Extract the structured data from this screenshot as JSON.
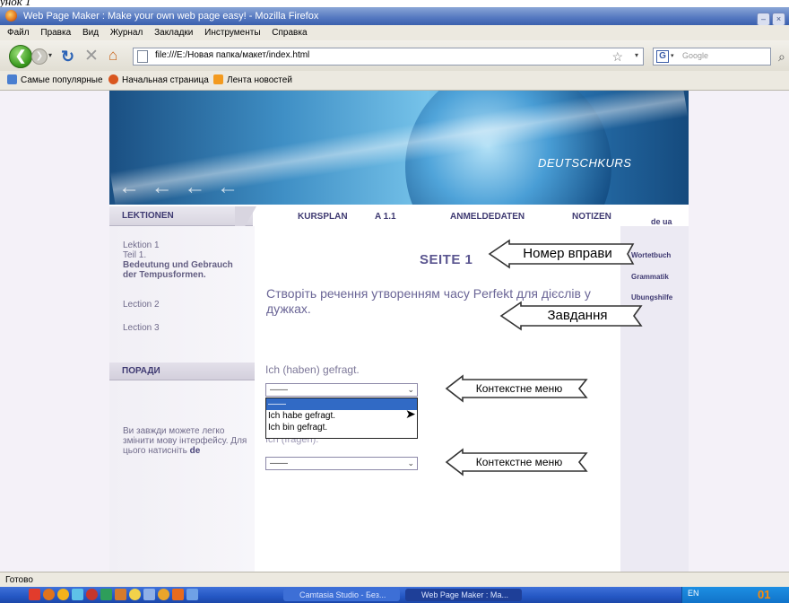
{
  "caption": "унок 1",
  "window": {
    "title": "Web Page Maker : Make your own web page easy! - Mozilla Firefox",
    "minimize": "–",
    "close": "×"
  },
  "menu": [
    "Файл",
    "Правка",
    "Вид",
    "Журнал",
    "Закладки",
    "Инструменты",
    "Справка"
  ],
  "nav": {
    "back_glyph": "❮",
    "forward_glyph": "❯",
    "dropdown_glyph": "▾",
    "reload_glyph": "↻",
    "stop_glyph": "✕",
    "home_glyph": "⌂",
    "url": "file:///E:/Новая папка/макет/index.html",
    "star_glyph": "☆",
    "search_placeholder": "Google",
    "search_engine_glyph": "G",
    "search_go_glyph": "⌕"
  },
  "bookmarks": [
    "Самые популярные",
    "Начальная страница",
    "Лента новостей"
  ],
  "icons": {
    "bookmark_popular": "bookmarks-folder-icon",
    "bookmark_start": "firefox-icon",
    "bookmark_news": "rss-feed-icon"
  },
  "page": {
    "banner_title": "DEUTSCHKURS",
    "banner_arrows": "← ← ← ←",
    "lektionen_header": "LEKTIONEN",
    "topnav": [
      "KURSPLAN",
      "A 1.1",
      "ANMELDEDATEN",
      "NOTIZEN"
    ],
    "lang_switch": "de  ua",
    "lessons": {
      "lektion1": "Lektion 1",
      "teil1": "Teil 1.",
      "teil1_title": "Bedeutung und Gebrauch der Tempusformen.",
      "lection2": "Lection 2",
      "lection3": "Lection 3"
    },
    "tips_header": "ПОРАДИ",
    "tips_text_prefix": "Ви завжди можете легко змінити мову інтерфейсу. Для цього натисніть ",
    "tips_text_bold": "de",
    "side_links": [
      "Wortetbuch",
      "Grammatik",
      "Ubungshilfe"
    ],
    "seite": "SEITE 1",
    "task": "Створіть речення утворенням часу Perfekt для дієслів у дужках.",
    "q1": "Ich (haben) gefragt.",
    "q2": "Ich (fragen).",
    "select1_value": "——",
    "select2_value": "——",
    "dropdown_options": [
      "——",
      "Ich habe gefragt.",
      "Ich bin gefragt."
    ],
    "dropdown_selected_index": 0
  },
  "callouts": {
    "exercise_number": "Номер вправи",
    "task": "Завдання",
    "context_menu_1": "Контекстне меню",
    "context_menu_2": "Контекстне меню"
  },
  "status": "Готово",
  "taskbar": {
    "tasks": [
      "Camtasia Studio - Без...",
      "Web Page Maker : Ма..."
    ],
    "lang": "EN",
    "clock": "01"
  },
  "colors": {
    "titlebar": "#3a60ad",
    "page_accent": "#3f3a72",
    "callout_fill": "#ffffff",
    "taskbar": "#2457c4"
  }
}
